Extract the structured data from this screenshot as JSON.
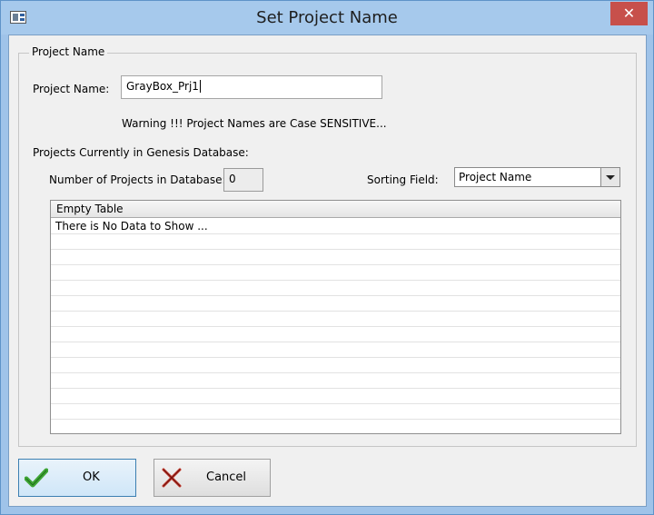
{
  "window": {
    "title": "Set Project Name",
    "close_glyph": "✕"
  },
  "group": {
    "legend": "Project Name"
  },
  "project_name": {
    "label": "Project Name:",
    "value": "GrayBox_Prj1"
  },
  "warning": "Warning !!! Project Names are Case SENSITIVE...",
  "projects_section": {
    "label": "Projects Currently in Genesis Database:"
  },
  "count": {
    "label": "Number of Projects in Database:",
    "value": "0"
  },
  "sorting": {
    "label": "Sorting Field:",
    "selected": "Project Name"
  },
  "table": {
    "header": "Empty Table",
    "rows": [
      "There is No Data to Show ...",
      "",
      "",
      "",
      "",
      "",
      "",
      "",
      "",
      "",
      "",
      "",
      ""
    ]
  },
  "buttons": {
    "ok": "OK",
    "cancel": "Cancel"
  },
  "icons": {
    "app": "app-window-icon",
    "ok": "check-icon",
    "cancel": "x-icon"
  },
  "colors": {
    "title_bar": "#a6c9ec",
    "close": "#c7504b",
    "check": "#3fa535",
    "cancel_x": "#c0392b"
  }
}
